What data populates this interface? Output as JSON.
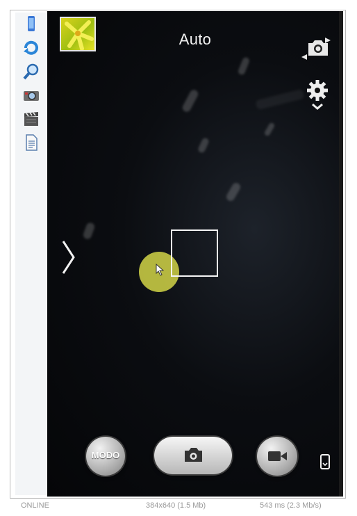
{
  "camera": {
    "mode_label": "Auto",
    "mode_button_label": "MODO"
  },
  "toolbar": {
    "tools": [
      "device-icon",
      "rotate-icon",
      "zoom-icon",
      "screenshot-icon",
      "video-record-icon",
      "document-icon"
    ]
  },
  "statusbar": {
    "left": "ONLINE",
    "center": "384x640 (1.5 Mb)",
    "right": "543 ms (2.3 Mb/s)"
  },
  "colors": {
    "viewfinder_bg": "#050608",
    "touch_indicator": "#ccce46",
    "focus_box": "#f5f5f5"
  }
}
